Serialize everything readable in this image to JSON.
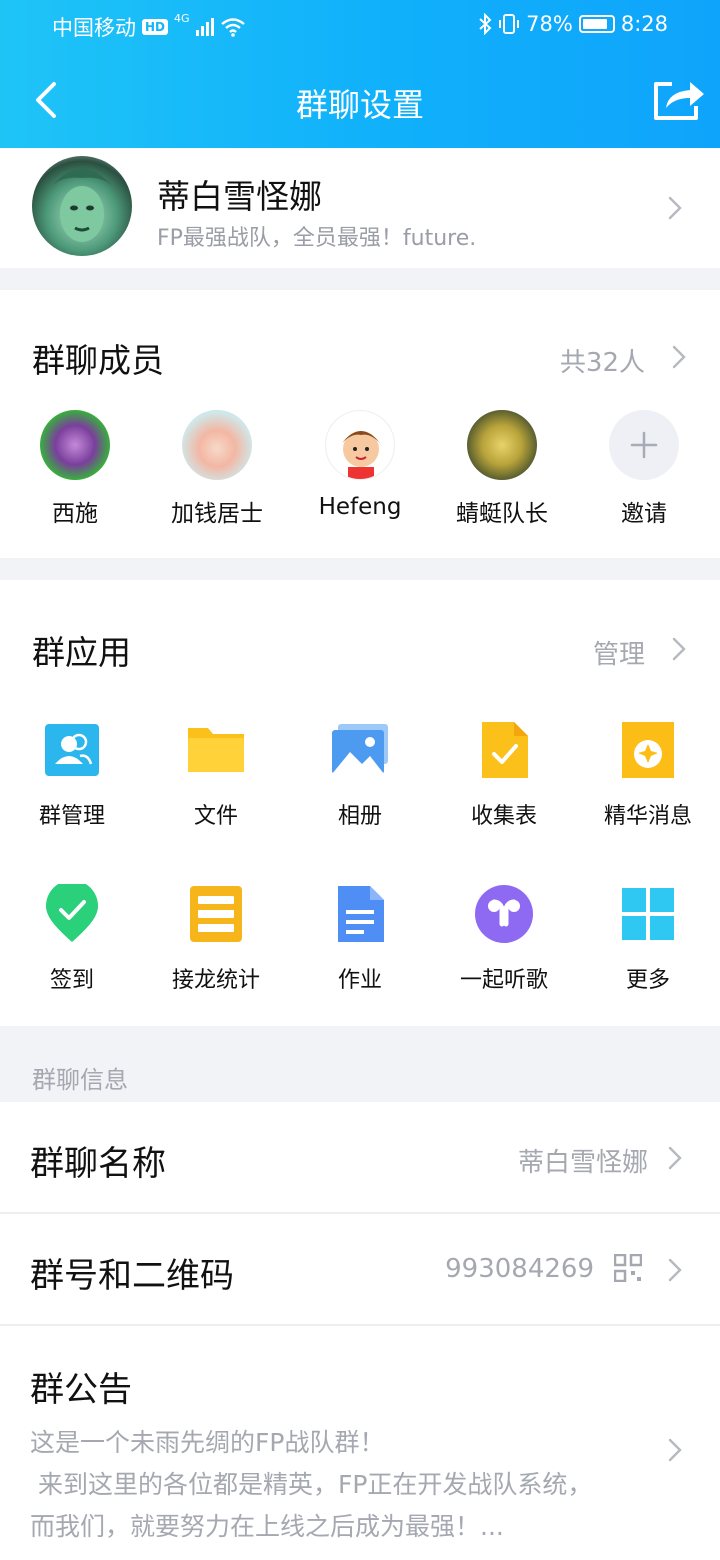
{
  "status_bar": {
    "carrier": "中国移动",
    "hd": "HD",
    "net": "4G",
    "battery": "78%",
    "time": "8:28"
  },
  "nav": {
    "title": "群聊设置"
  },
  "group": {
    "name": "蒂白雪怪娜",
    "subtitle": "FP最强战队，全员最强！future."
  },
  "members": {
    "title": "群聊成员",
    "count": "共32人",
    "list": [
      {
        "name": "西施"
      },
      {
        "name": "加钱居士"
      },
      {
        "name": "Hefeng"
      },
      {
        "name": "蜻蜓队长"
      },
      {
        "name": "邀请"
      }
    ]
  },
  "apps": {
    "title": "群应用",
    "manage": "管理",
    "items": [
      {
        "label": "群管理",
        "icon": "group-manage-icon"
      },
      {
        "label": "文件",
        "icon": "folder-icon"
      },
      {
        "label": "相册",
        "icon": "photo-album-icon"
      },
      {
        "label": "收集表",
        "icon": "collection-form-icon"
      },
      {
        "label": "精华消息",
        "icon": "essence-message-icon"
      },
      {
        "label": "签到",
        "icon": "check-in-icon"
      },
      {
        "label": "接龙统计",
        "icon": "relay-stats-icon"
      },
      {
        "label": "作业",
        "icon": "homework-icon"
      },
      {
        "label": "一起听歌",
        "icon": "listen-together-icon"
      },
      {
        "label": "更多",
        "icon": "more-apps-icon"
      }
    ]
  },
  "info": {
    "section_label": "群聊信息",
    "name_row": {
      "title": "群聊名称",
      "value": "蒂白雪怪娜"
    },
    "number_row": {
      "title": "群号和二维码",
      "value": "993084269"
    },
    "notice": {
      "title": "群公告",
      "line1": "这是一个未雨先绸的FP战队群！",
      "line2": " 来到这里的各位都是精英，FP正在开发战队系统，",
      "line3": "而我们，就要努力在上线之后成为最强！..."
    }
  },
  "colors": {
    "header_start": "#1fc4f7",
    "header_end": "#0fa4fb",
    "secondary_text": "#a5a8b0"
  }
}
